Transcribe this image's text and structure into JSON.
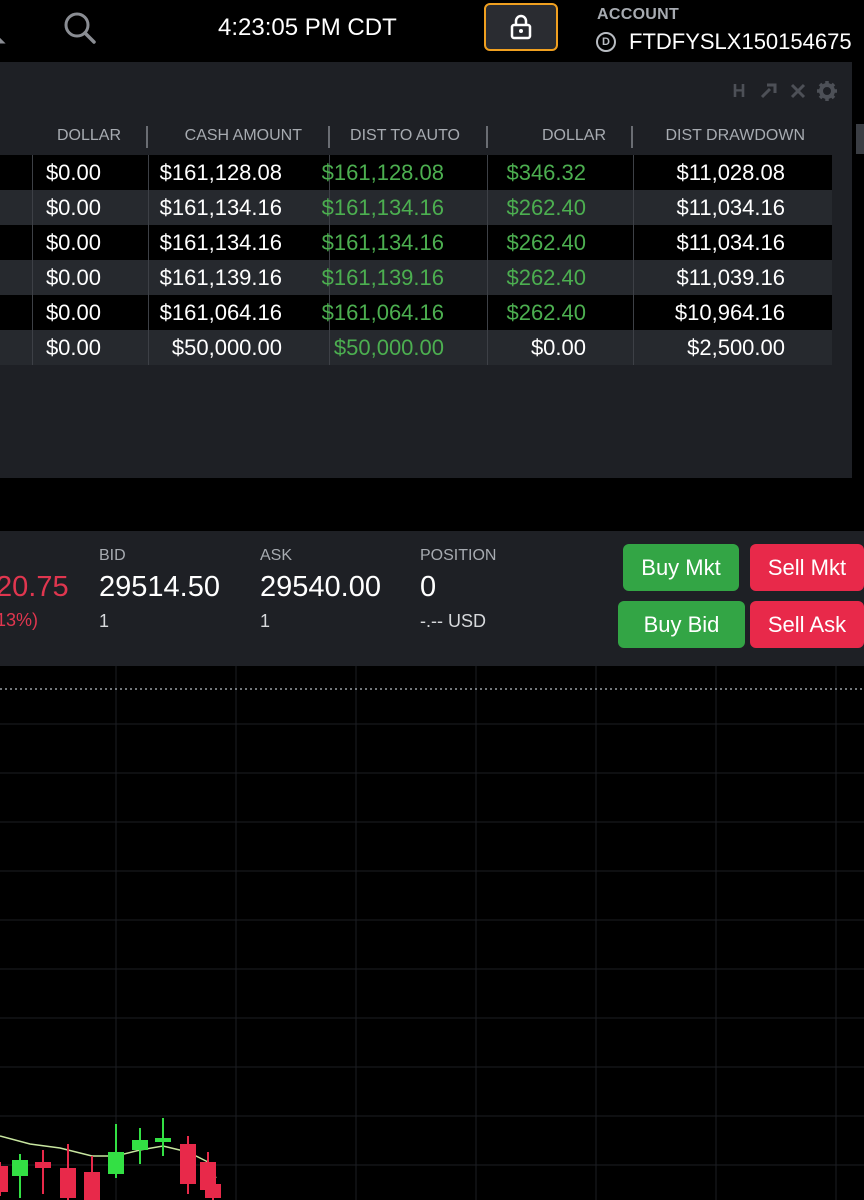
{
  "header": {
    "clock": "4:23:05 PM CDT",
    "account_label": "ACCOUNT",
    "account_badge": "D",
    "account_id": "FTDFYSLX150154675"
  },
  "icons": [
    "bell-icon",
    "search-icon",
    "lock-icon",
    "pin-icon",
    "close-icon",
    "gear-icon"
  ],
  "panel": {
    "tools": {
      "h_label": "H"
    },
    "columns": [
      "DOLLAR",
      "CASH AMOUNT",
      "DIST TO AUTO",
      "DOLLAR",
      "DIST DRAWDOWN"
    ],
    "rows": [
      [
        "$0.00",
        "$161,128.08",
        "$161,128.08",
        "$346.32",
        "$11,028.08"
      ],
      [
        "$0.00",
        "$161,134.16",
        "$161,134.16",
        "$262.40",
        "$11,034.16"
      ],
      [
        "$0.00",
        "$161,134.16",
        "$161,134.16",
        "$262.40",
        "$11,034.16"
      ],
      [
        "$0.00",
        "$161,139.16",
        "$161,139.16",
        "$262.40",
        "$11,039.16"
      ],
      [
        "$0.00",
        "$161,064.16",
        "$161,064.16",
        "$262.40",
        "$10,964.16"
      ],
      [
        "$0.00",
        "$50,000.00",
        "$50,000.00",
        "$0.00",
        "$2,500.00"
      ]
    ],
    "green_columns": [
      2,
      3
    ],
    "green_exceptions": [
      [
        5,
        3
      ]
    ]
  },
  "quote": {
    "last_price": "20.75",
    "change_pct": "13%)",
    "bid_label": "BID",
    "bid_value": "29514.50",
    "bid_size": "1",
    "ask_label": "ASK",
    "ask_value": "29540.00",
    "ask_size": "1",
    "position_label": "POSITION",
    "position_value": "0",
    "position_pnl": "-.-- USD"
  },
  "buttons": {
    "buy_mkt": "Buy Mkt",
    "sell_mkt": "Sell Mkt",
    "buy_bid": "Buy Bid",
    "sell_ask": "Sell Ask"
  },
  "colors": {
    "background": "#000000",
    "panel": "#1e2025",
    "green": "#4caf50",
    "red": "#e0364f",
    "buy_button": "#33a545",
    "sell_button": "#e8294a",
    "lock_border": "#f0a020"
  },
  "chart": {
    "candles": [
      {
        "dir": "down"
      },
      {
        "dir": "up"
      },
      {
        "dir": "down"
      },
      {
        "dir": "down"
      },
      {
        "dir": "down"
      },
      {
        "dir": "up"
      },
      {
        "dir": "up"
      },
      {
        "dir": "up"
      },
      {
        "dir": "down"
      },
      {
        "dir": "down"
      },
      {
        "dir": "down"
      }
    ]
  }
}
